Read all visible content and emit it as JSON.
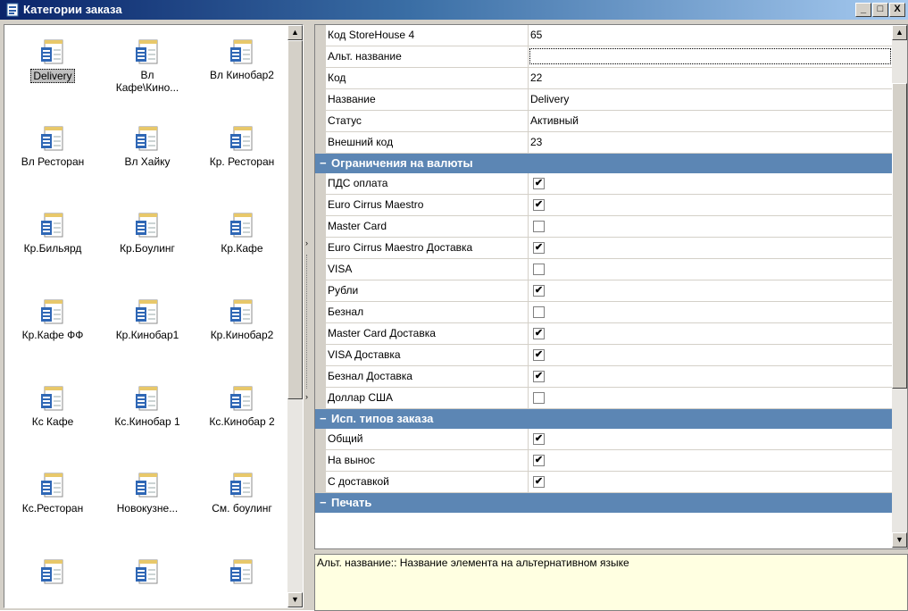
{
  "window": {
    "title": "Категории заказа",
    "buttons": {
      "minimize": "_",
      "maximize": "□",
      "close": "X"
    }
  },
  "categories": [
    {
      "label": "Delivery",
      "selected": true
    },
    {
      "label": "Вл\nКафе\\Кино...",
      "selected": false
    },
    {
      "label": "Вл Кинобар2",
      "selected": false
    },
    {
      "label": "Вл Ресторан",
      "selected": false
    },
    {
      "label": "Вл Хайку",
      "selected": false
    },
    {
      "label": "Кр. Ресторан",
      "selected": false
    },
    {
      "label": "Кр.Бильярд",
      "selected": false
    },
    {
      "label": "Кр.Боулинг",
      "selected": false
    },
    {
      "label": "Кр.Кафе",
      "selected": false
    },
    {
      "label": "Кр.Кафе ФФ",
      "selected": false
    },
    {
      "label": "Кр.Кинобар1",
      "selected": false
    },
    {
      "label": "Кр.Кинобар2",
      "selected": false
    },
    {
      "label": "Кс Кафе",
      "selected": false
    },
    {
      "label": "Кс.Кинобар 1",
      "selected": false
    },
    {
      "label": "Кс.Кинобар 2",
      "selected": false
    },
    {
      "label": "Кс.Ресторан",
      "selected": false
    },
    {
      "label": "Новокузне...",
      "selected": false
    },
    {
      "label": "См. боулинг",
      "selected": false
    },
    {
      "label": "",
      "selected": false
    },
    {
      "label": "",
      "selected": false
    },
    {
      "label": "",
      "selected": false
    }
  ],
  "properties": {
    "rows": [
      {
        "type": "field",
        "name": "Код StoreHouse 4",
        "value": "65"
      },
      {
        "type": "edit",
        "name": "Альт. название",
        "value": ""
      },
      {
        "type": "field",
        "name": "Код",
        "value": "22"
      },
      {
        "type": "field",
        "name": "Название",
        "value": "Delivery"
      },
      {
        "type": "field",
        "name": "Статус",
        "value": "Активный"
      },
      {
        "type": "field",
        "name": "Внешний код",
        "value": "23"
      },
      {
        "type": "category",
        "name": "Ограничения на валюты"
      },
      {
        "type": "check",
        "name": "ПДС оплата",
        "checked": true
      },
      {
        "type": "check",
        "name": "Euro Cirrus Maestro",
        "checked": true
      },
      {
        "type": "check",
        "name": "Master Card",
        "checked": false
      },
      {
        "type": "check",
        "name": "Euro Cirrus Maestro Доставка",
        "checked": true
      },
      {
        "type": "check",
        "name": "VISA",
        "checked": false
      },
      {
        "type": "check",
        "name": "Рубли",
        "checked": true
      },
      {
        "type": "check",
        "name": "Безнал",
        "checked": false
      },
      {
        "type": "check",
        "name": "Master Card Доставка",
        "checked": true
      },
      {
        "type": "check",
        "name": "VISA Доставка",
        "checked": true
      },
      {
        "type": "check",
        "name": "Безнал  Доставка",
        "checked": true
      },
      {
        "type": "check",
        "name": "Доллар США",
        "checked": false
      },
      {
        "type": "category",
        "name": "Исп. типов заказа"
      },
      {
        "type": "check",
        "name": "Общий",
        "checked": true
      },
      {
        "type": "check",
        "name": "На вынос",
        "checked": true
      },
      {
        "type": "check",
        "name": "С доставкой",
        "checked": true
      },
      {
        "type": "category",
        "name": "Печать"
      }
    ],
    "category_collapse_glyph": "−",
    "check_glyph": "✔"
  },
  "description": "Альт. название:: Название элемента на альтернативном языке",
  "scroll": {
    "up": "▲",
    "down": "▼",
    "split_arrow": "›"
  },
  "colors": {
    "category_header": "#5c86b4",
    "description_bg": "#ffffe1",
    "title_start": "#0a246a"
  }
}
